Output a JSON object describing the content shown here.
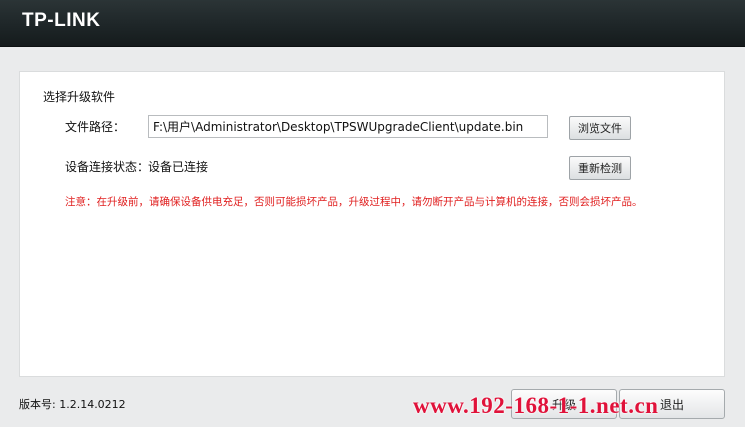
{
  "header": {
    "logo_text": "TP-LINK"
  },
  "panel": {
    "section_title": "选择升级软件",
    "file_path_label": "文件路径：",
    "file_path_value": "F:\\用户\\Administrator\\Desktop\\TPSWUpgradeClient\\update.bin",
    "browse_button": "浏览文件",
    "connection_label": "设备连接状态：",
    "connection_value": "设备已连接",
    "redetect_button": "重新检测",
    "warning": "注意：在升级前，请确保设备供电充足，否则可能损坏产品，升级过程中，请勿断开产品与计算机的连接，否则会损坏产品。"
  },
  "footer": {
    "version": "版本号: 1.2.14.0212",
    "upgrade_button": "升级",
    "exit_button": "退出"
  },
  "watermark": {
    "text": "www.192-168-1-1.net.cn"
  },
  "colors": {
    "header_bg": "#1e2628",
    "warning_text": "#e02020",
    "watermark": "#e0123a"
  }
}
